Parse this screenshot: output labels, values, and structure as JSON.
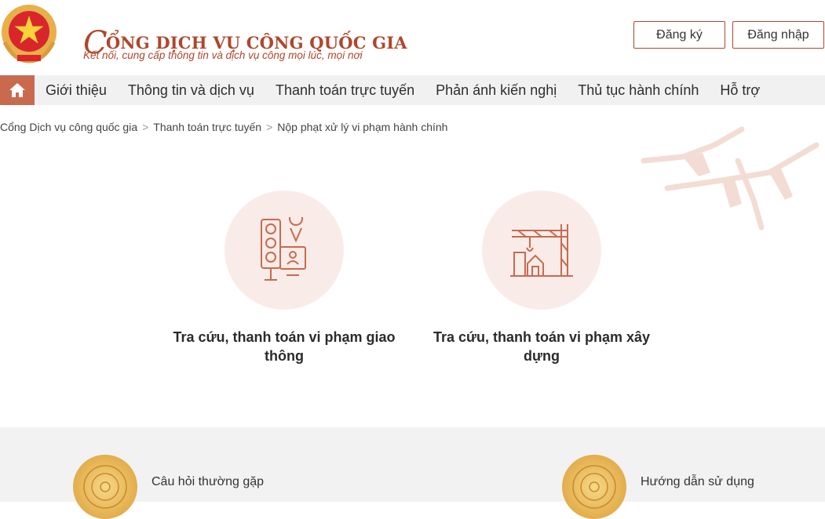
{
  "header": {
    "title_first_letter": "C",
    "title_rest": "ỔNG DỊCH VỤ CÔNG QUỐC GIA",
    "subtitle": "Kết nối, cung cấp thông tin và dịch vụ công mọi lúc, mọi nơi",
    "register_label": "Đăng ký",
    "login_label": "Đăng nhập",
    "accent_color": "#b0462c"
  },
  "nav": {
    "home_icon": "home-icon",
    "items": [
      {
        "label": "Giới thiệu"
      },
      {
        "label": "Thông tin và dịch vụ"
      },
      {
        "label": "Thanh toán trực tuyến"
      },
      {
        "label": "Phản ánh kiến nghị"
      },
      {
        "label": "Thủ tục hành chính"
      },
      {
        "label": "Hỗ trợ"
      }
    ]
  },
  "breadcrumb": {
    "items": [
      {
        "label": "Cổng Dịch vụ công quốc gia"
      },
      {
        "label": "Thanh toán trực tuyến"
      },
      {
        "label": "Nộp phạt xử lý vi phạm hành chính"
      }
    ],
    "separator": ">"
  },
  "cards": [
    {
      "label": "Tra cứu, thanh toán vi phạm giao thông",
      "icon": "traffic-light-icon"
    },
    {
      "label": "Tra cứu, thanh toán vi phạm xây dựng",
      "icon": "construction-crane-icon"
    }
  ],
  "footer": {
    "items": [
      {
        "label": "Câu hỏi thường gặp",
        "icon": "emblem-seal-icon"
      },
      {
        "label": "Hướng dẫn sử dụng",
        "icon": "emblem-seal-icon"
      }
    ]
  }
}
